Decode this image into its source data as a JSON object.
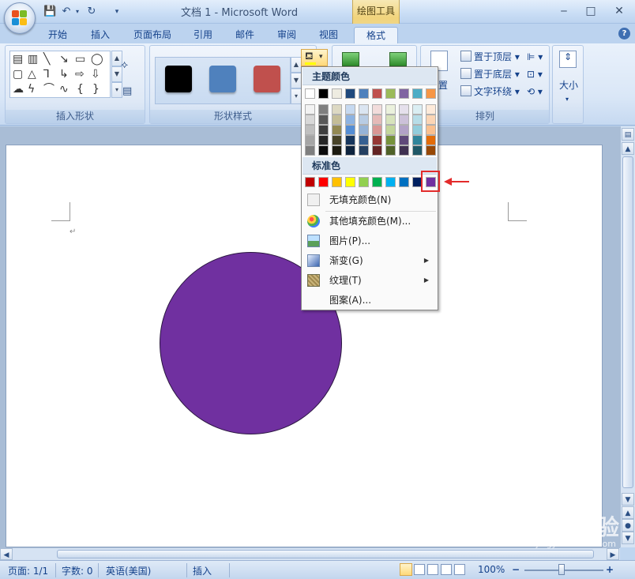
{
  "window": {
    "title": "文档 1 - Microsoft Word",
    "contextual_tab_title": "绘图工具",
    "minimize": "‒",
    "restore": "□",
    "close": "✕"
  },
  "tabs": [
    {
      "label": "开始"
    },
    {
      "label": "插入"
    },
    {
      "label": "页面布局"
    },
    {
      "label": "引用"
    },
    {
      "label": "邮件"
    },
    {
      "label": "审阅"
    },
    {
      "label": "视图"
    },
    {
      "label": "格式"
    }
  ],
  "ribbon": {
    "groups": {
      "insert_shapes": "插入形状",
      "shape_styles": "形状样式",
      "arrange": "排列"
    },
    "arrange_buttons": {
      "bring_to_front": "置于顶层",
      "send_to_back": "置于底层",
      "text_wrap": "文字环绕",
      "position": "置"
    },
    "size_button": "大小",
    "style_swatch_colors": [
      "#000000",
      "#4f81bd",
      "#c0504d"
    ]
  },
  "fill_menu": {
    "theme_colors_header": "主题颜色",
    "standard_colors_header": "标准色",
    "theme_top_row": [
      "#ffffff",
      "#000000",
      "#eeece1",
      "#1f497d",
      "#4f81bd",
      "#c0504d",
      "#9bbb59",
      "#8064a2",
      "#4bacc6",
      "#f79646"
    ],
    "theme_shades": [
      [
        "#f2f2f2",
        "#7f7f7f",
        "#ddd9c3",
        "#c6d9f0",
        "#dbe5f1",
        "#f2dcdb",
        "#ebf1dd",
        "#e5e0ec",
        "#dbeef3",
        "#fdeada"
      ],
      [
        "#d8d8d8",
        "#595959",
        "#c4bd97",
        "#8db3e2",
        "#b8cce4",
        "#e5b9b7",
        "#d7e3bc",
        "#ccc1d9",
        "#b7dde8",
        "#fbd5b5"
      ],
      [
        "#bfbfbf",
        "#3f3f3f",
        "#938953",
        "#548dd4",
        "#95b3d7",
        "#d99694",
        "#c3d69b",
        "#b2a2c7",
        "#92cddc",
        "#fac08f"
      ],
      [
        "#a5a5a5",
        "#262626",
        "#494429",
        "#17365d",
        "#366092",
        "#953734",
        "#76923c",
        "#5f497a",
        "#31859b",
        "#e36c09"
      ],
      [
        "#7f7f7f",
        "#0c0c0c",
        "#1d1b10",
        "#0f243e",
        "#244061",
        "#632423",
        "#4f6128",
        "#3f3151",
        "#205867",
        "#974806"
      ]
    ],
    "standard_colors": [
      "#c00000",
      "#ff0000",
      "#ffc000",
      "#ffff00",
      "#92d050",
      "#00b050",
      "#00b0f0",
      "#0070c0",
      "#002060",
      "#7030a0"
    ],
    "items": [
      {
        "label": "无填充颜色(N)"
      },
      {
        "label": "其他填充颜色(M)..."
      },
      {
        "label": "图片(P)..."
      },
      {
        "label": "渐变(G)"
      },
      {
        "label": "纹理(T)"
      },
      {
        "label": "图案(A)..."
      }
    ]
  },
  "document": {
    "circle_fill": "#7030a0"
  },
  "status": {
    "page": "页面: 1/1",
    "words": "字数: 0",
    "language": "英语(美国)",
    "insert_mode": "插入",
    "zoom": "100%",
    "zoom_minus": "−",
    "zoom_plus": "+"
  },
  "watermark": {
    "brand": "Bai du 经验",
    "url": "jingyan.baidu.com"
  }
}
